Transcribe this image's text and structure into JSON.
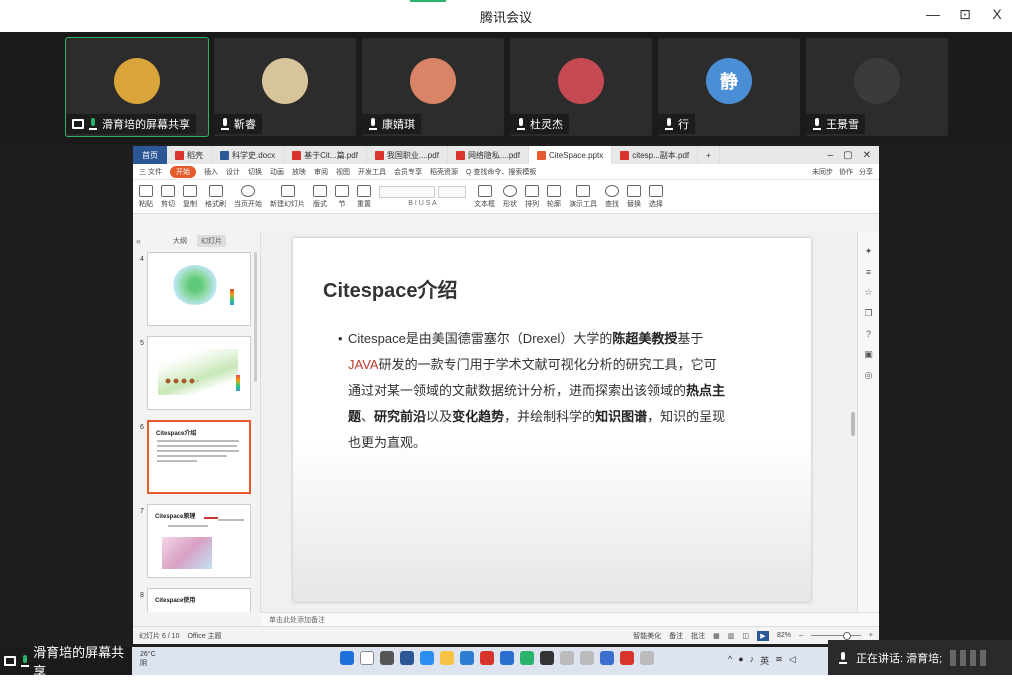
{
  "window": {
    "title": "腾讯会议",
    "controls": [
      "—",
      "⊡",
      "X"
    ]
  },
  "gallery": [
    {
      "name": "滑育培的屏幕共享",
      "color": "#d9a43a",
      "initial": "",
      "active": true
    },
    {
      "name": "靳睿",
      "color": "#d8c49a",
      "initial": ""
    },
    {
      "name": "康婧琪",
      "color": "#d98467",
      "initial": ""
    },
    {
      "name": "杜灵杰",
      "color": "#c64a52",
      "initial": ""
    },
    {
      "name": "行",
      "color": "#4a8fd6",
      "initial": "静"
    },
    {
      "name": "王景雪",
      "color": "#3b3b3b",
      "initial": ""
    }
  ],
  "wps": {
    "home_tab": "首页",
    "tabs": [
      {
        "label": "稻壳",
        "color": "#d9342b"
      },
      {
        "label": "科学史.docx",
        "color": "#2b5797"
      },
      {
        "label": "基于Cit...篇.pdf",
        "color": "#d9342b"
      },
      {
        "label": "我国职业....pdf",
        "color": "#d9342b"
      },
      {
        "label": "网络隐私....pdf",
        "color": "#d9342b"
      },
      {
        "label": "CiteSpace.pptx",
        "color": "#e65b2c",
        "current": true
      },
      {
        "label": "citesp...副本.pdf",
        "color": "#d9342b"
      }
    ],
    "menu": [
      "三 文件",
      "开始",
      "插入",
      "设计",
      "切换",
      "动画",
      "放映",
      "审阅",
      "视图",
      "开发工具",
      "会员专享",
      "稻壳资源",
      "Q 查找命令、搜索模板"
    ],
    "menu_right": [
      "未同步",
      "协作",
      "分享"
    ],
    "ribbon": [
      "粘贴",
      "剪切",
      "复制",
      "格式刷",
      "当页开始",
      "新建幻灯片",
      "版式",
      "节",
      "重置",
      "文本框",
      "形状",
      "排列",
      "轮廓",
      "演示工具",
      "查找",
      "替换",
      "选择"
    ],
    "panel_tabs": [
      "大纲",
      "幻灯片"
    ],
    "notes_placeholder": "单击此处添加备注",
    "status": {
      "slide": "幻灯片 6 / 10",
      "theme": "Office 主题",
      "beautify": "智能美化",
      "notes": "备注",
      "comments": "批注",
      "zoom": "82%"
    }
  },
  "thumbnails": [
    {
      "num": "4"
    },
    {
      "num": "5"
    },
    {
      "num": "6",
      "title": "Citespace介绍",
      "selected": true
    },
    {
      "num": "7",
      "title": "Citespace原理"
    },
    {
      "num": "8",
      "title": "Citespace使用"
    }
  ],
  "slide": {
    "title": "Citespace介绍",
    "p1": "Citespace是由美国德雷塞尔（Drexel）大学的",
    "p1b": "陈超美教授",
    "p1c": "基于",
    "p1red": "JAVA",
    "p1d": "研发的一款专门用于学术文献可视化分析的研究工具，它可通过对某一领域的文献数据统计分析，进而探索出该领域的",
    "p1e": "热点主题",
    "p1f": "、",
    "p1g": "研究前沿",
    "p1h": "以及",
    "p1i": "变化趋势",
    "p1j": "，并绘制科学的",
    "p1k": "知识图谱",
    "p1l": "，知识的呈现也更为直观。"
  },
  "taskbar": {
    "share_label": "滑育培的屏幕共享",
    "weather_temp": "26°C",
    "weather_desc": "阴",
    "speaking": "正在讲话: 滑育培;"
  },
  "colors": {
    "accent": "#2ab36b",
    "wps_orange": "#e65b2c",
    "red_text": "#c0392b"
  }
}
